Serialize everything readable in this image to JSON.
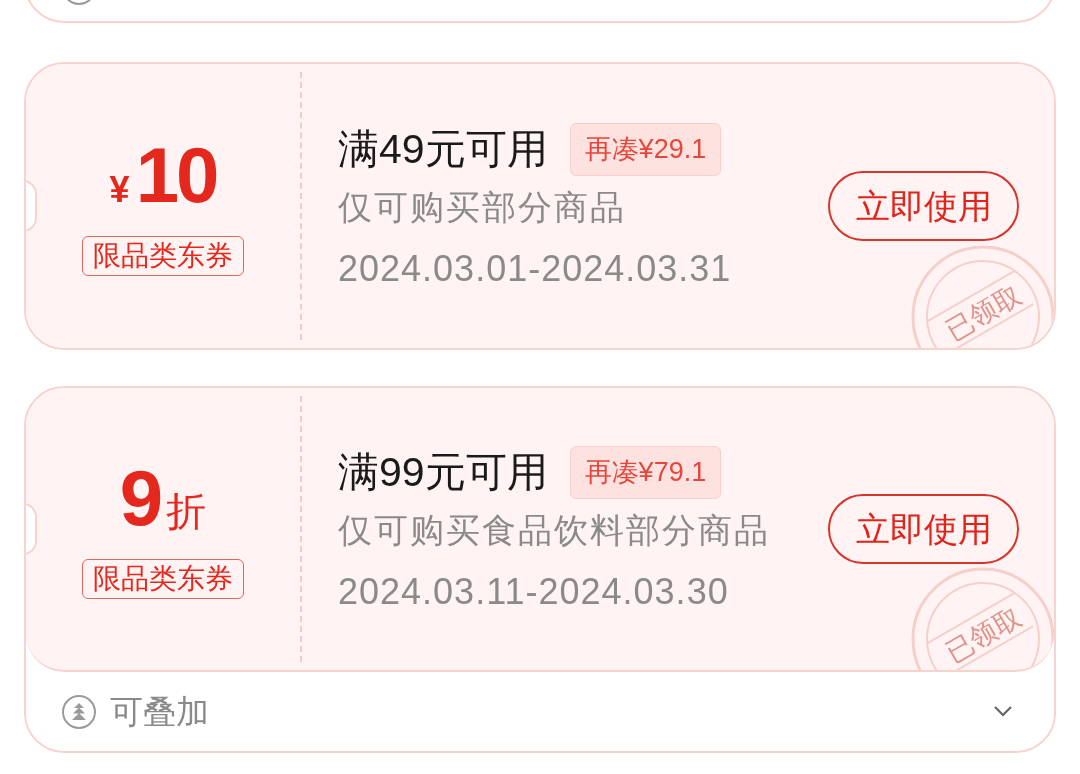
{
  "clipped_card_above": {
    "stackable_icon": true
  },
  "coupons": [
    {
      "kind": "cash",
      "unit": "¥",
      "amount": "10",
      "scope_badge": "限品类东券",
      "threshold": "满49元可用",
      "shortfall_tag": "再凑¥29.1",
      "description": "仅可购买部分商品",
      "validity": "2024.03.01-2024.03.31",
      "action": "立即使用",
      "stamp": "已领取"
    },
    {
      "kind": "discount",
      "unit": "折",
      "amount": "9",
      "scope_badge": "限品类东券",
      "threshold": "满99元可用",
      "shortfall_tag": "再凑¥79.1",
      "description": "仅可购买食品饮料部分商品",
      "validity": "2024.03.11-2024.03.30",
      "action": "立即使用",
      "stamp": "已领取",
      "footer": {
        "label": "可叠加",
        "expanded": false
      }
    }
  ]
}
